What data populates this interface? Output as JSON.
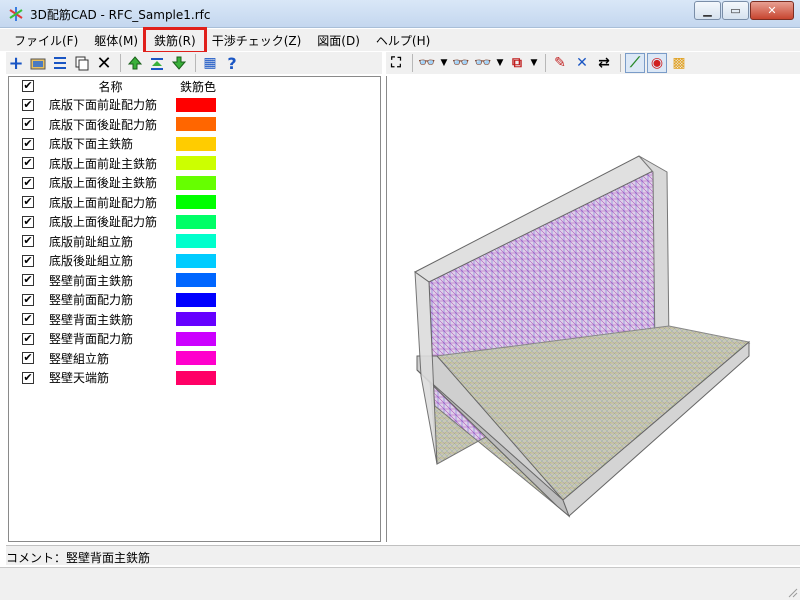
{
  "window": {
    "title": "3D配筋CAD - RFC_Sample1.rfc"
  },
  "menu": [
    {
      "label": "ファイル(F)",
      "highlighted": false
    },
    {
      "label": "躯体(M)",
      "highlighted": false
    },
    {
      "label": "鉄筋(R)",
      "highlighted": true
    },
    {
      "label": "干渉チェック(Z)",
      "highlighted": false
    },
    {
      "label": "図面(D)",
      "highlighted": false
    },
    {
      "label": "ヘルプ(H)",
      "highlighted": false
    }
  ],
  "toolbar_left": [
    "add-icon",
    "open-folder-icon",
    "align-icon",
    "copy-icon",
    "delete-icon",
    "move-up-icon",
    "import-icon",
    "move-down-icon",
    "grid-icon",
    "help-icon"
  ],
  "toolbar_right": [
    "fit-view-icon",
    "binoculars-icon",
    "binoculars-red-icon",
    "binoculars-red-icon",
    "view-menu-icon",
    "snap-icon",
    "cross-icon",
    "swap-icon",
    "wireframe-icon",
    "target-icon",
    "palette-icon"
  ],
  "table": {
    "header": {
      "check": "☑",
      "name": "名称",
      "color": "鉄筋色"
    },
    "rows": [
      {
        "name": "底版下面前趾配力筋",
        "color": "#ff0000",
        "checked": true
      },
      {
        "name": "底版下面後趾配力筋",
        "color": "#ff6600",
        "checked": true
      },
      {
        "name": "底版下面主鉄筋",
        "color": "#ffcc00",
        "checked": true
      },
      {
        "name": "底版上面前趾主鉄筋",
        "color": "#ccff00",
        "checked": true
      },
      {
        "name": "底版上面後趾主鉄筋",
        "color": "#66ff00",
        "checked": true
      },
      {
        "name": "底版上面前趾配力筋",
        "color": "#00ff00",
        "checked": true
      },
      {
        "name": "底版上面後趾配力筋",
        "color": "#00ff66",
        "checked": true
      },
      {
        "name": "底版前趾組立筋",
        "color": "#00ffcc",
        "checked": true
      },
      {
        "name": "底版後趾組立筋",
        "color": "#00ccff",
        "checked": true
      },
      {
        "name": "竪壁前面主鉄筋",
        "color": "#0066ff",
        "checked": true
      },
      {
        "name": "竪壁前面配力筋",
        "color": "#0000ff",
        "checked": true
      },
      {
        "name": "竪壁背面主鉄筋",
        "color": "#6600ff",
        "checked": true
      },
      {
        "name": "竪壁背面配力筋",
        "color": "#cc00ff",
        "checked": true
      },
      {
        "name": "竪壁組立筋",
        "color": "#ff00cc",
        "checked": true
      },
      {
        "name": "竪壁天端筋",
        "color": "#ff0066",
        "checked": true
      }
    ]
  },
  "status": {
    "comment": "コメント：竪壁背面主鉄筋"
  }
}
